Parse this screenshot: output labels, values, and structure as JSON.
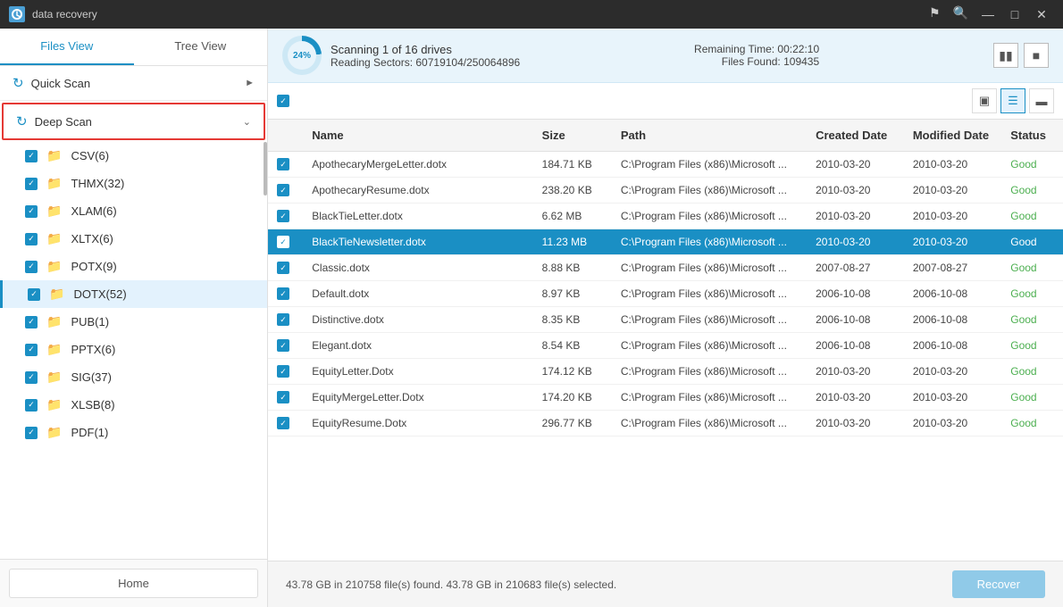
{
  "app": {
    "title": "data recovery",
    "logo_text": "DR"
  },
  "titlebar": {
    "controls": {
      "minimize": "—",
      "maximize": "□",
      "close": "✕",
      "icon1": "⚑",
      "icon2": "🔍"
    }
  },
  "tabs": {
    "files_view": "Files View",
    "tree_view": "Tree View"
  },
  "sidebar": {
    "quick_scan_label": "Quick Scan",
    "deep_scan_label": "Deep Scan",
    "items": [
      {
        "label": "CSV(6)",
        "checked": true
      },
      {
        "label": "THMX(32)",
        "checked": true
      },
      {
        "label": "XLAM(6)",
        "checked": true
      },
      {
        "label": "XLTX(6)",
        "checked": true
      },
      {
        "label": "POTX(9)",
        "checked": true
      },
      {
        "label": "DOTX(52)",
        "checked": true,
        "active": true
      },
      {
        "label": "PUB(1)",
        "checked": true
      },
      {
        "label": "PPTX(6)",
        "checked": true
      },
      {
        "label": "SIG(37)",
        "checked": true
      },
      {
        "label": "XLSB(8)",
        "checked": true
      },
      {
        "label": "PDF(1)",
        "checked": true
      }
    ]
  },
  "home_button": "Home",
  "scan_progress": {
    "percent": "24%",
    "line1": "Scanning 1 of  16 drives",
    "line2": "Reading Sectors: 60719104/250064896",
    "remaining_label": "Remaining Time: 00:22:10",
    "files_found_label": "Files Found: 109435"
  },
  "toolbar": {
    "view_grid_icon": "⊞",
    "view_list_icon": "☰",
    "view_detail_icon": "▤"
  },
  "table": {
    "headers": [
      "",
      "Name",
      "Size",
      "Path",
      "Created Date",
      "Modified Date",
      "Status"
    ],
    "rows": [
      {
        "name": "ApothecaryMergeLetter.dotx",
        "size": "184.71 KB",
        "path": "C:\\Program Files (x86)\\Microsoft ...",
        "created": "2010-03-20",
        "modified": "2010-03-20",
        "status": "Good",
        "selected": false,
        "checked": true
      },
      {
        "name": "ApothecaryResume.dotx",
        "size": "238.20 KB",
        "path": "C:\\Program Files (x86)\\Microsoft ...",
        "created": "2010-03-20",
        "modified": "2010-03-20",
        "status": "Good",
        "selected": false,
        "checked": true
      },
      {
        "name": "BlackTieLetter.dotx",
        "size": "6.62 MB",
        "path": "C:\\Program Files (x86)\\Microsoft ...",
        "created": "2010-03-20",
        "modified": "2010-03-20",
        "status": "Good",
        "selected": false,
        "checked": true
      },
      {
        "name": "BlackTieNewsletter.dotx",
        "size": "11.23 MB",
        "path": "C:\\Program Files (x86)\\Microsoft ...",
        "created": "2010-03-20",
        "modified": "2010-03-20",
        "status": "Good",
        "selected": true,
        "checked": true
      },
      {
        "name": "Classic.dotx",
        "size": "8.88 KB",
        "path": "C:\\Program Files (x86)\\Microsoft ...",
        "created": "2007-08-27",
        "modified": "2007-08-27",
        "status": "Good",
        "selected": false,
        "checked": true
      },
      {
        "name": "Default.dotx",
        "size": "8.97 KB",
        "path": "C:\\Program Files (x86)\\Microsoft ...",
        "created": "2006-10-08",
        "modified": "2006-10-08",
        "status": "Good",
        "selected": false,
        "checked": true
      },
      {
        "name": "Distinctive.dotx",
        "size": "8.35 KB",
        "path": "C:\\Program Files (x86)\\Microsoft ...",
        "created": "2006-10-08",
        "modified": "2006-10-08",
        "status": "Good",
        "selected": false,
        "checked": true
      },
      {
        "name": "Elegant.dotx",
        "size": "8.54 KB",
        "path": "C:\\Program Files (x86)\\Microsoft ...",
        "created": "2006-10-08",
        "modified": "2006-10-08",
        "status": "Good",
        "selected": false,
        "checked": true
      },
      {
        "name": "EquityLetter.Dotx",
        "size": "174.12 KB",
        "path": "C:\\Program Files (x86)\\Microsoft ...",
        "created": "2010-03-20",
        "modified": "2010-03-20",
        "status": "Good",
        "selected": false,
        "checked": true
      },
      {
        "name": "EquityMergeLetter.Dotx",
        "size": "174.20 KB",
        "path": "C:\\Program Files (x86)\\Microsoft ...",
        "created": "2010-03-20",
        "modified": "2010-03-20",
        "status": "Good",
        "selected": false,
        "checked": true
      },
      {
        "name": "EquityResume.Dotx",
        "size": "296.77 KB",
        "path": "C:\\Program Files (x86)\\Microsoft ...",
        "created": "2010-03-20",
        "modified": "2010-03-20",
        "status": "Good",
        "selected": false,
        "checked": true
      }
    ]
  },
  "status_bar": {
    "text": "43.78 GB in 210758 file(s) found.   43.78 GB in 210683 file(s) selected.",
    "recover_label": "Recover"
  }
}
